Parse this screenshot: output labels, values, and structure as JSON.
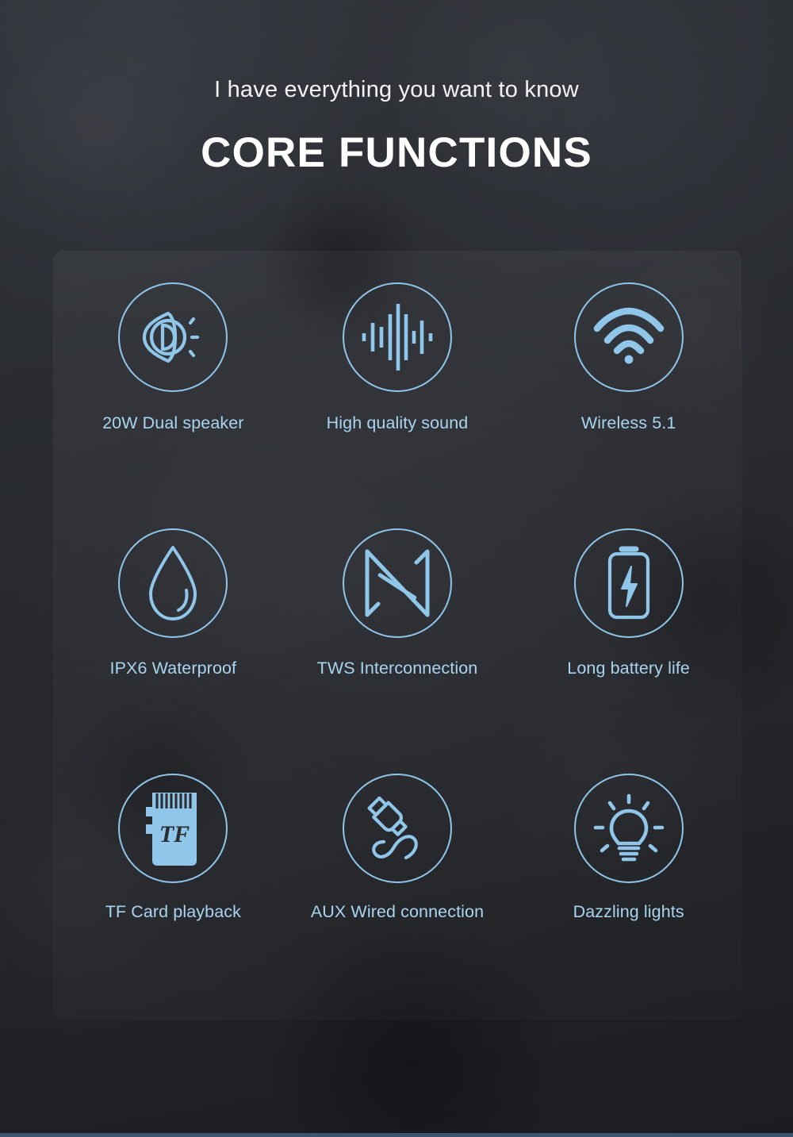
{
  "header": {
    "subtitle": "I have everything you want to know",
    "title": "CORE FUNCTIONS"
  },
  "colors": {
    "accent": "#8fc6e9",
    "label_text": "#a9d5ef",
    "title_text": "#ffffff",
    "background": "#24262a",
    "panel": "rgba(255,255,255,0.035)",
    "bottom_strip": "#3e536f"
  },
  "features": [
    {
      "icon": "dual-speaker-icon",
      "label": "20W Dual speaker"
    },
    {
      "icon": "sound-waveform-icon",
      "label": "High quality sound"
    },
    {
      "icon": "wifi-wireless-icon",
      "label": "Wireless 5.1"
    },
    {
      "icon": "water-droplet-icon",
      "label": "IPX6 Waterproof"
    },
    {
      "icon": "tws-interconnection-icon",
      "label": "TWS Interconnection"
    },
    {
      "icon": "battery-charge-icon",
      "label": "Long battery life"
    },
    {
      "icon": "tf-card-icon",
      "label": "TF Card playback"
    },
    {
      "icon": "aux-cable-plug-icon",
      "label": "AUX Wired connection"
    },
    {
      "icon": "lightbulb-icon",
      "label": "Dazzling lights"
    }
  ],
  "tf_card": {
    "text": "TF"
  }
}
